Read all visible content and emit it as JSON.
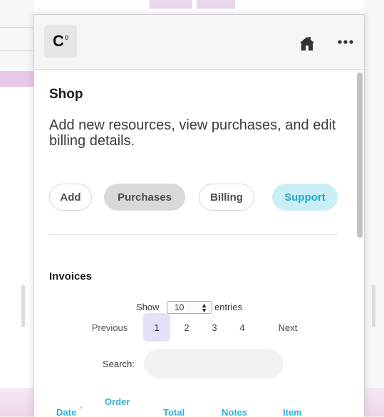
{
  "app": {
    "logo_text": "C",
    "logo_sup": "0"
  },
  "header": {
    "icons": [
      "home-icon",
      "more-icon"
    ]
  },
  "shop": {
    "title": "Shop",
    "subtitle": "Add new resources, view purchases, and edit billing details."
  },
  "tabs": [
    {
      "label": "Add"
    },
    {
      "label": "Purchases",
      "active": true
    },
    {
      "label": "Billing"
    },
    {
      "label": "Support",
      "accent": "#1fa9cc"
    }
  ],
  "invoices": {
    "heading": "Invoices",
    "show_label": "Show",
    "entries_value": "10",
    "entries_label": "entries",
    "pagination": {
      "previous": "Previous",
      "pages": [
        "1",
        "2",
        "3",
        "4"
      ],
      "current": "1",
      "next": "Next"
    },
    "search_label": "Search:",
    "search_value": "",
    "columns": {
      "date": "Date",
      "order": "Order",
      "total": "Total",
      "notes": "Notes",
      "item": "Item"
    }
  },
  "colors": {
    "accent": "#2eb0d6",
    "support_bg": "#c9eef6",
    "active_page_bg": "#e5e0f7"
  }
}
